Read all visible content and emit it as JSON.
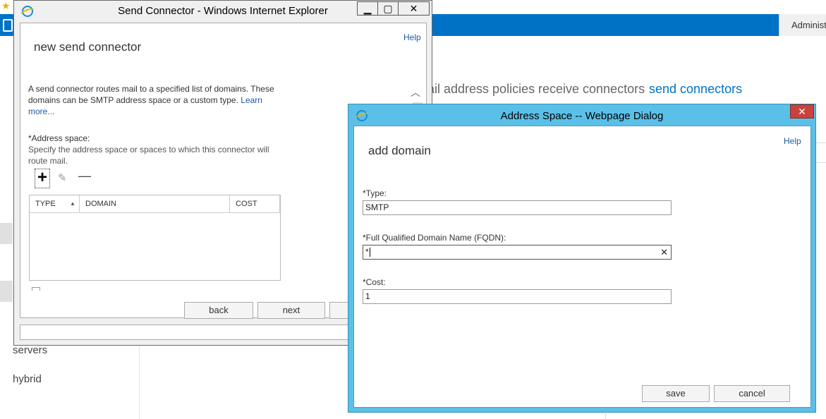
{
  "background": {
    "admin_label": "Administr",
    "tabs": [
      "ail address policies",
      "receive connectors",
      "send connectors"
    ],
    "nav": {
      "servers": "servers",
      "hybrid": "hybrid"
    },
    "accent": "#0072c6"
  },
  "send_window": {
    "title": "Send Connector - Windows Internet Explorer",
    "help": "Help",
    "heading": "new send connector",
    "description": "A send connector routes mail to a specified list of domains. These domains can be SMTP address space or a custom type.",
    "learn_more": "Learn more...",
    "address_space_label": "*Address space:",
    "address_space_hint": "Specify the address space or spaces to which this connector will route mail.",
    "grid": {
      "columns": [
        "TYPE",
        "DOMAIN",
        "COST"
      ],
      "rows": []
    },
    "buttons": {
      "back": "back",
      "next": "next"
    },
    "icons": {
      "add": "plus-icon",
      "edit": "pencil-icon",
      "remove": "minus-icon"
    }
  },
  "addr_dialog": {
    "title": "Address Space -- Webpage Dialog",
    "help": "Help",
    "heading": "add domain",
    "type_label": "*Type:",
    "type_value": "SMTP",
    "fqdn_label": "*Full Qualified Domain Name (FQDN):",
    "fqdn_value": "*",
    "cost_label": "*Cost:",
    "cost_value": "1",
    "buttons": {
      "save": "save",
      "cancel": "cancel"
    },
    "accent": "#5bc0e8"
  }
}
